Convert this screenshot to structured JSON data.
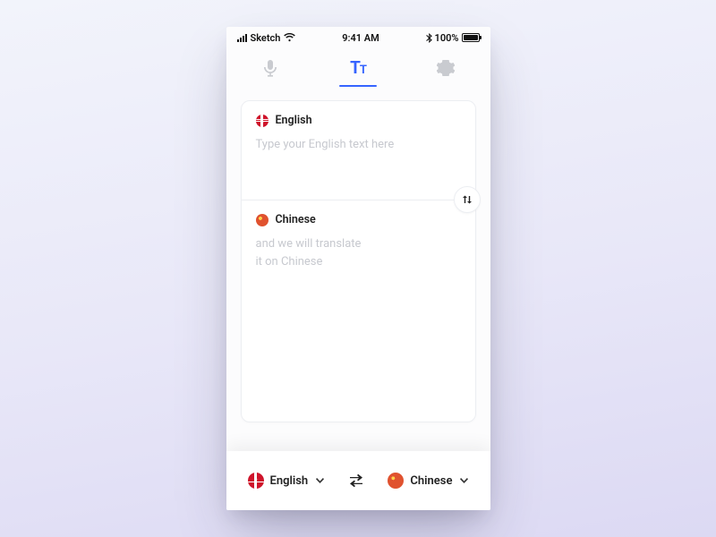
{
  "status": {
    "carrier": "Sketch",
    "time": "9:41 AM",
    "battery_pct": "100%"
  },
  "tabs": {
    "voice_name": "voice",
    "text_name": "text",
    "settings_name": "settings"
  },
  "card": {
    "source": {
      "language": "English",
      "placeholder": "Type your English text here"
    },
    "target": {
      "language": "Chinese",
      "placeholder_line1": "and we will translate",
      "placeholder_line2": "it on Chinese"
    }
  },
  "bottom": {
    "source_lang": "English",
    "target_lang": "Chinese"
  }
}
